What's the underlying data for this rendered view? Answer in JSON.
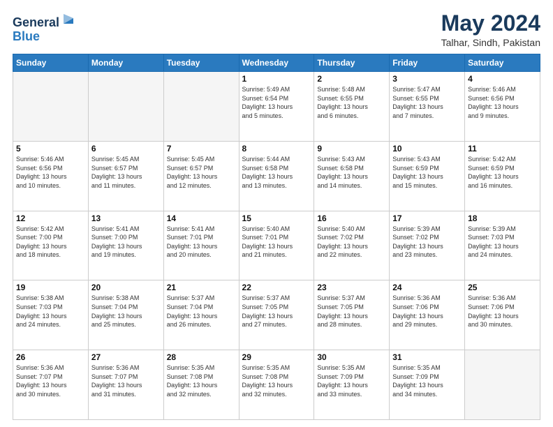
{
  "header": {
    "logo_line1": "General",
    "logo_line2": "Blue",
    "title": "May 2024",
    "subtitle": "Talhar, Sindh, Pakistan"
  },
  "weekdays": [
    "Sunday",
    "Monday",
    "Tuesday",
    "Wednesday",
    "Thursday",
    "Friday",
    "Saturday"
  ],
  "weeks": [
    [
      {
        "day": "",
        "info": ""
      },
      {
        "day": "",
        "info": ""
      },
      {
        "day": "",
        "info": ""
      },
      {
        "day": "1",
        "info": "Sunrise: 5:49 AM\nSunset: 6:54 PM\nDaylight: 13 hours\nand 5 minutes."
      },
      {
        "day": "2",
        "info": "Sunrise: 5:48 AM\nSunset: 6:55 PM\nDaylight: 13 hours\nand 6 minutes."
      },
      {
        "day": "3",
        "info": "Sunrise: 5:47 AM\nSunset: 6:55 PM\nDaylight: 13 hours\nand 7 minutes."
      },
      {
        "day": "4",
        "info": "Sunrise: 5:46 AM\nSunset: 6:56 PM\nDaylight: 13 hours\nand 9 minutes."
      }
    ],
    [
      {
        "day": "5",
        "info": "Sunrise: 5:46 AM\nSunset: 6:56 PM\nDaylight: 13 hours\nand 10 minutes."
      },
      {
        "day": "6",
        "info": "Sunrise: 5:45 AM\nSunset: 6:57 PM\nDaylight: 13 hours\nand 11 minutes."
      },
      {
        "day": "7",
        "info": "Sunrise: 5:45 AM\nSunset: 6:57 PM\nDaylight: 13 hours\nand 12 minutes."
      },
      {
        "day": "8",
        "info": "Sunrise: 5:44 AM\nSunset: 6:58 PM\nDaylight: 13 hours\nand 13 minutes."
      },
      {
        "day": "9",
        "info": "Sunrise: 5:43 AM\nSunset: 6:58 PM\nDaylight: 13 hours\nand 14 minutes."
      },
      {
        "day": "10",
        "info": "Sunrise: 5:43 AM\nSunset: 6:59 PM\nDaylight: 13 hours\nand 15 minutes."
      },
      {
        "day": "11",
        "info": "Sunrise: 5:42 AM\nSunset: 6:59 PM\nDaylight: 13 hours\nand 16 minutes."
      }
    ],
    [
      {
        "day": "12",
        "info": "Sunrise: 5:42 AM\nSunset: 7:00 PM\nDaylight: 13 hours\nand 18 minutes."
      },
      {
        "day": "13",
        "info": "Sunrise: 5:41 AM\nSunset: 7:00 PM\nDaylight: 13 hours\nand 19 minutes."
      },
      {
        "day": "14",
        "info": "Sunrise: 5:41 AM\nSunset: 7:01 PM\nDaylight: 13 hours\nand 20 minutes."
      },
      {
        "day": "15",
        "info": "Sunrise: 5:40 AM\nSunset: 7:01 PM\nDaylight: 13 hours\nand 21 minutes."
      },
      {
        "day": "16",
        "info": "Sunrise: 5:40 AM\nSunset: 7:02 PM\nDaylight: 13 hours\nand 22 minutes."
      },
      {
        "day": "17",
        "info": "Sunrise: 5:39 AM\nSunset: 7:02 PM\nDaylight: 13 hours\nand 23 minutes."
      },
      {
        "day": "18",
        "info": "Sunrise: 5:39 AM\nSunset: 7:03 PM\nDaylight: 13 hours\nand 24 minutes."
      }
    ],
    [
      {
        "day": "19",
        "info": "Sunrise: 5:38 AM\nSunset: 7:03 PM\nDaylight: 13 hours\nand 24 minutes."
      },
      {
        "day": "20",
        "info": "Sunrise: 5:38 AM\nSunset: 7:04 PM\nDaylight: 13 hours\nand 25 minutes."
      },
      {
        "day": "21",
        "info": "Sunrise: 5:37 AM\nSunset: 7:04 PM\nDaylight: 13 hours\nand 26 minutes."
      },
      {
        "day": "22",
        "info": "Sunrise: 5:37 AM\nSunset: 7:05 PM\nDaylight: 13 hours\nand 27 minutes."
      },
      {
        "day": "23",
        "info": "Sunrise: 5:37 AM\nSunset: 7:05 PM\nDaylight: 13 hours\nand 28 minutes."
      },
      {
        "day": "24",
        "info": "Sunrise: 5:36 AM\nSunset: 7:06 PM\nDaylight: 13 hours\nand 29 minutes."
      },
      {
        "day": "25",
        "info": "Sunrise: 5:36 AM\nSunset: 7:06 PM\nDaylight: 13 hours\nand 30 minutes."
      }
    ],
    [
      {
        "day": "26",
        "info": "Sunrise: 5:36 AM\nSunset: 7:07 PM\nDaylight: 13 hours\nand 30 minutes."
      },
      {
        "day": "27",
        "info": "Sunrise: 5:36 AM\nSunset: 7:07 PM\nDaylight: 13 hours\nand 31 minutes."
      },
      {
        "day": "28",
        "info": "Sunrise: 5:35 AM\nSunset: 7:08 PM\nDaylight: 13 hours\nand 32 minutes."
      },
      {
        "day": "29",
        "info": "Sunrise: 5:35 AM\nSunset: 7:08 PM\nDaylight: 13 hours\nand 32 minutes."
      },
      {
        "day": "30",
        "info": "Sunrise: 5:35 AM\nSunset: 7:09 PM\nDaylight: 13 hours\nand 33 minutes."
      },
      {
        "day": "31",
        "info": "Sunrise: 5:35 AM\nSunset: 7:09 PM\nDaylight: 13 hours\nand 34 minutes."
      },
      {
        "day": "",
        "info": ""
      }
    ]
  ]
}
